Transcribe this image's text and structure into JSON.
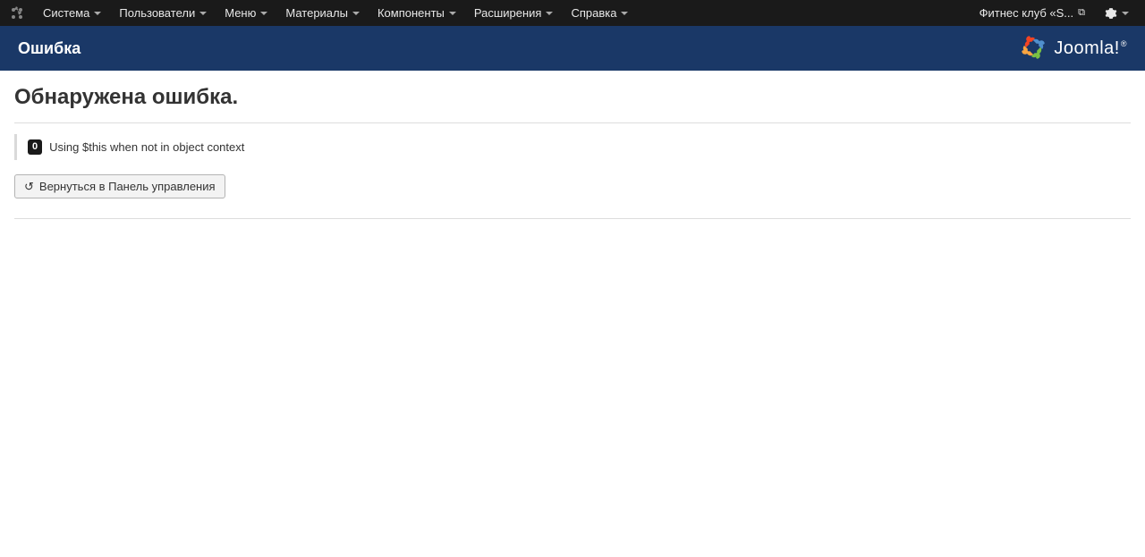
{
  "nav": {
    "items": [
      {
        "label": "Система"
      },
      {
        "label": "Пользователи"
      },
      {
        "label": "Меню"
      },
      {
        "label": "Материалы"
      },
      {
        "label": "Компоненты"
      },
      {
        "label": "Расширения"
      },
      {
        "label": "Справка"
      }
    ],
    "site_link": "Фитнес клуб «S..."
  },
  "header": {
    "title": "Ошибка",
    "brand": "Joomla!"
  },
  "main": {
    "heading": "Обнаружена ошибка.",
    "error_code": "0",
    "error_message": "Using $this when not in object context",
    "back_button": "Вернуться в Панель управления"
  }
}
